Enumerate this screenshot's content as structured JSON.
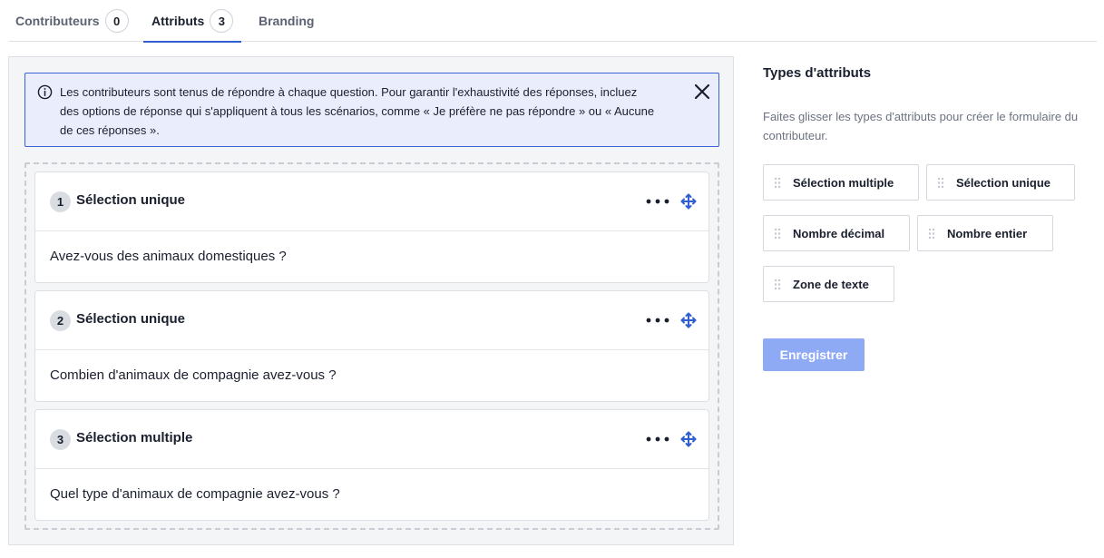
{
  "tabs": [
    {
      "label": "Contributeurs",
      "count": "0"
    },
    {
      "label": "Attributs",
      "count": "3"
    },
    {
      "label": "Branding"
    }
  ],
  "banner": {
    "text": "Les contributeurs sont tenus de répondre à chaque question. Pour garantir l'exhaustivité des réponses, incluez des options de réponse qui s'appliquent à tous les scénarios, comme « Je préfère ne pas répondre » ou « Aucune de ces réponses ».",
    "icon": "info-icon",
    "accent": "#3b63d6",
    "background": "#eaeefc"
  },
  "questions": [
    {
      "number": "1",
      "type": "Sélection unique",
      "text": "Avez-vous des animaux domestiques ?"
    },
    {
      "number": "2",
      "type": "Sélection unique",
      "text": "Combien d'animaux de compagnie avez-vous ?"
    },
    {
      "number": "3",
      "type": "Sélection multiple",
      "text": "Quel type d'animaux de compagnie avez-vous ?"
    }
  ],
  "sidebar": {
    "title": "Types d'attributs",
    "description": "Faites glisser les types d'attributs pour créer le formulaire du contributeur.",
    "types": [
      {
        "label": "Sélection multiple"
      },
      {
        "label": "Sélection unique"
      },
      {
        "label": "Nombre décimal"
      },
      {
        "label": "Nombre entier"
      },
      {
        "label": "Zone de texte"
      }
    ],
    "save_label": "Enregistrer"
  },
  "colors": {
    "accent": "#2f5fd0",
    "save_button": "#8faaf4"
  }
}
